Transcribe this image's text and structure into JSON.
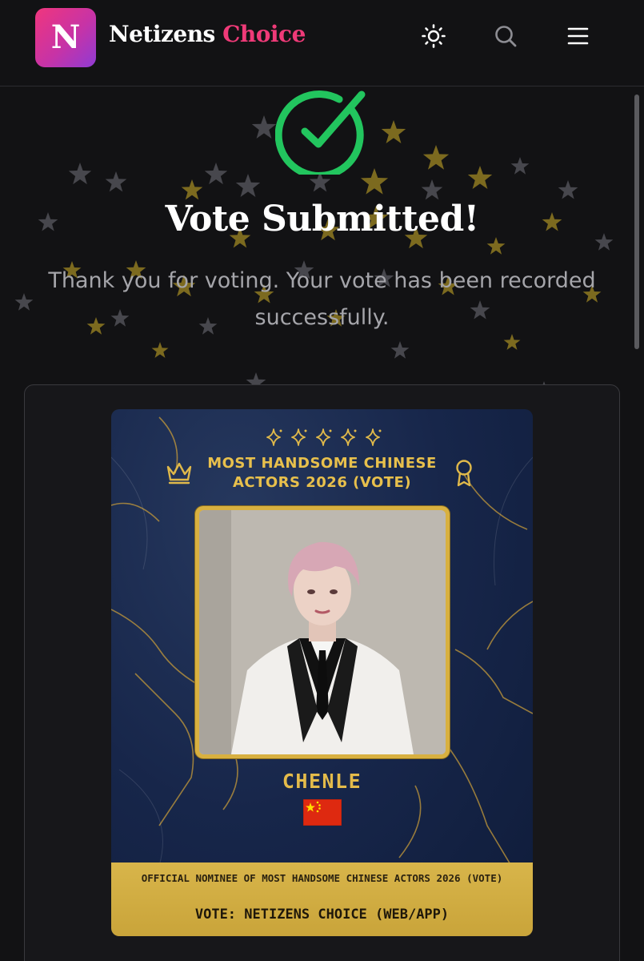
{
  "header": {
    "logo_letter": "N",
    "brand_part1": "Netizens",
    "brand_part2": "Choice",
    "icons": [
      "sun-icon",
      "search-icon",
      "menu-icon"
    ]
  },
  "result": {
    "icon": "check-circle-icon",
    "title": "Vote Submitted!",
    "message": "Thank you for voting. Your vote has been recorded successfully."
  },
  "poster": {
    "sparkle_icons": "5 x sparkles-icon",
    "title": "MOST HANDSOME CHINESE ACTORS 2026 (VOTE)",
    "nominee_name": "CHENLE",
    "flag": "china-flag",
    "footer_note": "OFFICIAL NOMINEE OF MOST HANDSOME CHINESE ACTORS 2026 (VOTE)",
    "footer_vote": "VOTE: NETIZENS CHOICE (WEB/APP)"
  },
  "colors": {
    "background": "#121214",
    "brand_accent": "#ef3a78",
    "success": "#22c55e",
    "gold": "#d8b040",
    "poster_navy": "#17264a"
  }
}
